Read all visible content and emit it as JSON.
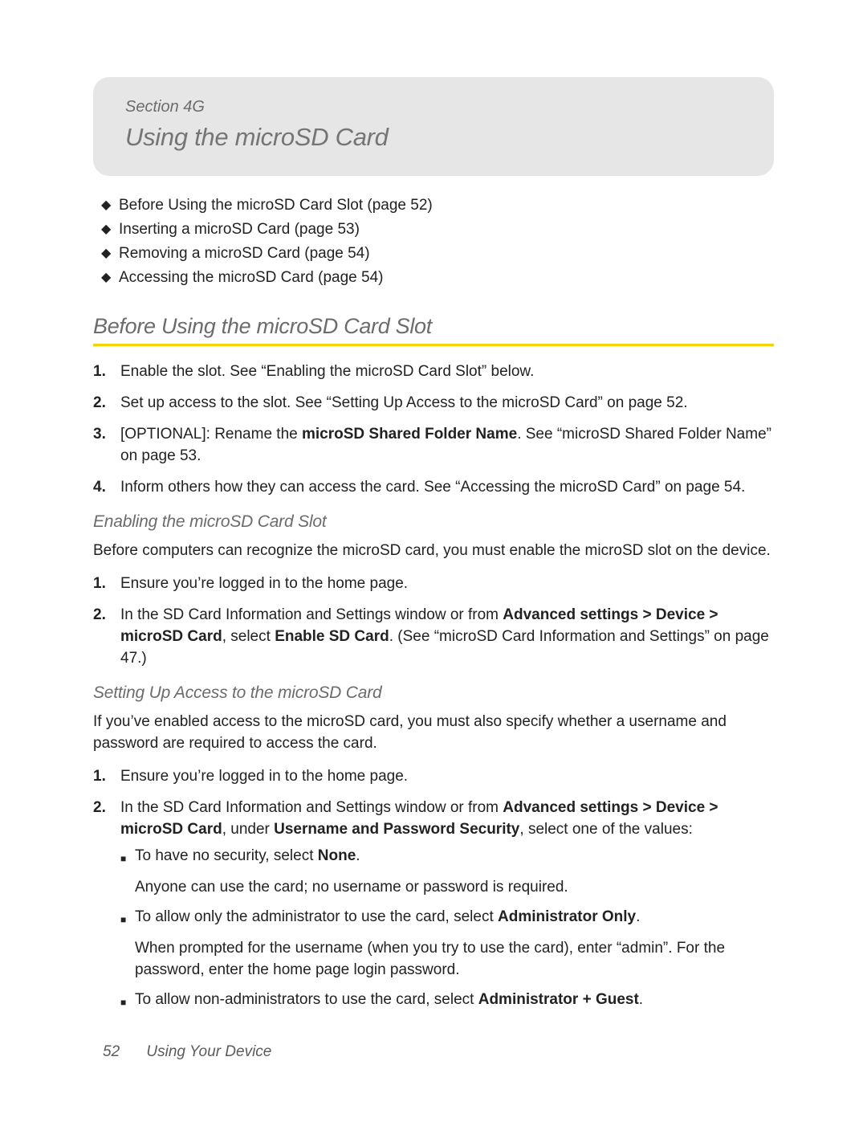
{
  "header": {
    "section_label": "Section 4G",
    "title": "Using the microSD Card"
  },
  "toc": [
    "Before Using the microSD Card Slot (page 52)",
    "Inserting a microSD Card (page 53)",
    "Removing a microSD Card (page 54)",
    "Accessing the microSD Card (page 54)"
  ],
  "h2_1": "Before Using the microSD Card Slot",
  "steps_a": {
    "s1": "Enable the slot. See “Enabling the microSD Card Slot” below.",
    "s2": "Set up access to the slot. See “Setting Up Access to the microSD Card” on page 52.",
    "s3_pre": "[OPTIONAL]: Rename the ",
    "s3_bold": "microSD Shared Folder Name",
    "s3_post": ". See “microSD Shared Folder Name” on page 53.",
    "s4": "Inform others how they can access the card. See “Accessing the microSD Card” on page 54."
  },
  "h3_enable": "Enabling the microSD Card Slot",
  "enable_intro": "Before computers can recognize the microSD card, you must enable the microSD slot on the device.",
  "enable_steps": {
    "e1": "Ensure you’re logged in to the home page.",
    "e2_a": "In the SD Card Information and Settings window or from ",
    "e2_b1": "Advanced settings",
    "e2_gt1": " > ",
    "e2_b2": "Device",
    "e2_gt2": " > ",
    "e2_b3": "microSD Card",
    "e2_mid": ", select ",
    "e2_b4": "Enable SD Card",
    "e2_end": ". (See “microSD Card Information and Settings” on page 47.)"
  },
  "h3_setting": "Setting Up Access to the microSD Card",
  "setting_intro": "If you’ve enabled access to the microSD card, you must also specify whether a username and password are required to access the card.",
  "setting_steps": {
    "ss1": "Ensure you’re logged in to the home page.",
    "ss2_a": "In the SD Card Information and Settings window or from ",
    "ss2_b1": "Advanced settings",
    "ss2_gt1": " > ",
    "ss2_b2": "Device",
    "ss2_gt2": " > ",
    "ss2_b3": "microSD Card",
    "ss2_mid": ", under ",
    "ss2_b4": "Username and Password Security",
    "ss2_end": ", select one of the values:"
  },
  "sub": {
    "li1_a": "To have no security, select ",
    "li1_b": "None",
    "li1_c": ".",
    "li1_follow": "Anyone can use the card; no username or password is required.",
    "li2_a": "To allow only the administrator to use the card, select ",
    "li2_b": "Administrator Only",
    "li2_c": ".",
    "li2_follow": "When prompted for the username (when you try to use the card), enter “admin”. For the password, enter the home page login password.",
    "li3_a": "To allow non-administrators to use the card, select ",
    "li3_b": "Administrator + Guest",
    "li3_c": "."
  },
  "footer": {
    "page": "52",
    "chapter": "Using Your Device"
  }
}
